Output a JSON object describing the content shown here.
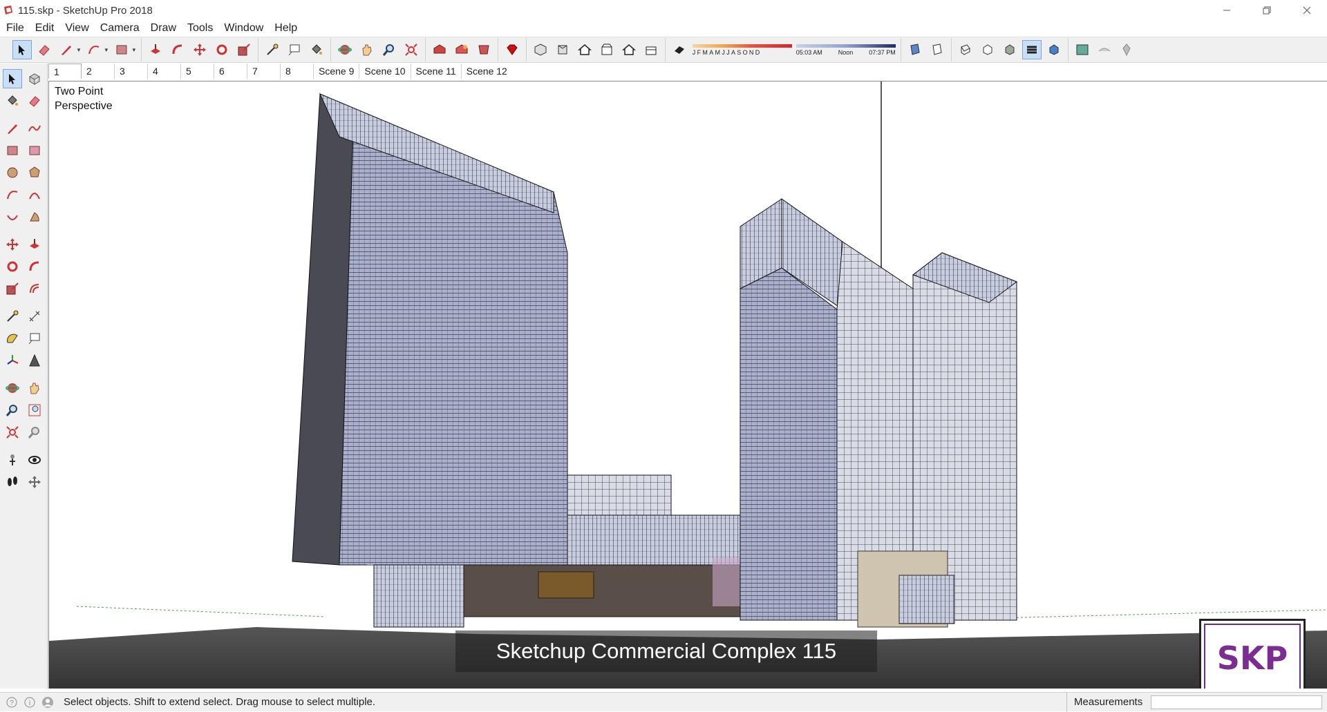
{
  "window": {
    "title": "115.skp - SketchUp Pro 2018",
    "controls": [
      "minimize",
      "restore",
      "close"
    ]
  },
  "menu": [
    "File",
    "Edit",
    "View",
    "Camera",
    "Draw",
    "Tools",
    "Window",
    "Help"
  ],
  "shadows": {
    "months": [
      "J",
      "F",
      "M",
      "A",
      "M",
      "J",
      "J",
      "A",
      "S",
      "O",
      "N",
      "D"
    ],
    "time_start": "05:03 AM",
    "time_mid": "Noon",
    "time_end": "07:37 PM"
  },
  "scenes": {
    "tabs": [
      "1",
      "2",
      "3",
      "4",
      "5",
      "6",
      "7",
      "8",
      "Scene 9",
      "Scene 10",
      "Scene 11",
      "Scene 12"
    ],
    "active_index": 0
  },
  "viewport": {
    "camera_label": "Two Point\nPerspective",
    "caption": "Sketchup Commercial Complex 115",
    "logo_text": "SKP"
  },
  "status": {
    "hint": "Select objects. Shift to extend select. Drag mouse to select multiple.",
    "measurements_label": "Measurements",
    "measurements_value": ""
  },
  "colors": {
    "logo_text": "#7b2d91",
    "active_tool_bg": "#c9dff5"
  }
}
